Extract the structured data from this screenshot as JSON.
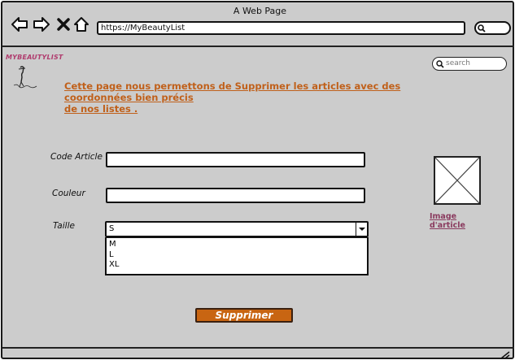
{
  "window": {
    "title": "A Web Page",
    "url": "https://MyBeautyList"
  },
  "logo": {
    "text": "MYBEAUTYLIST"
  },
  "search": {
    "placeholder": "search"
  },
  "intro": {
    "line1": "Cette page nous permettons de Supprimer les articles avec des coordonnées bien précis",
    "line2": "de nos listes ."
  },
  "form": {
    "code_label": "Code Article",
    "code_value": "",
    "color_label": "Couleur",
    "color_value": "",
    "size_label": "Taille",
    "size_selected": "S",
    "size_options": [
      "M",
      "L",
      "XL"
    ],
    "submit_label": "Supprimer"
  },
  "image": {
    "label": "Image d'article"
  },
  "colors": {
    "background": "#cccccc",
    "accent": "#c86512",
    "logo": "#b03c6e",
    "intro_text": "#c0601a"
  }
}
